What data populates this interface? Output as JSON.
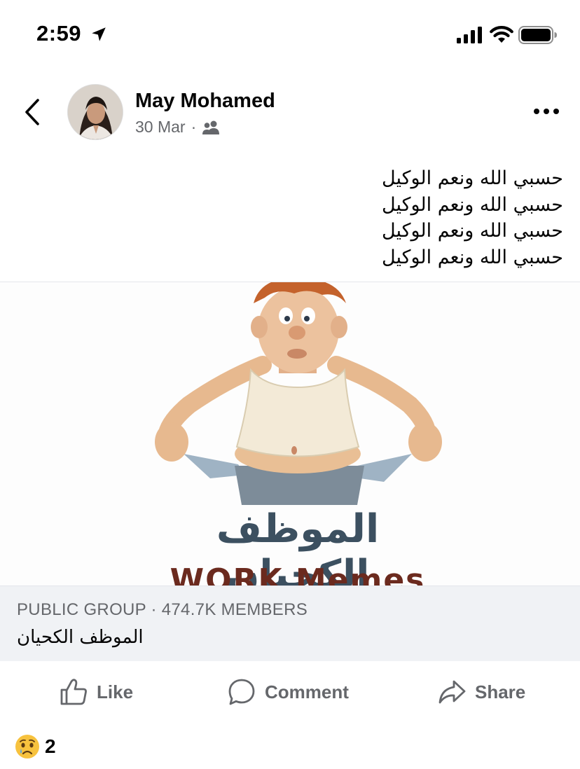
{
  "status_bar": {
    "time": "2:59",
    "icons": [
      "location-arrow-icon",
      "cellular-signal-icon",
      "wifi-icon",
      "battery-icon"
    ]
  },
  "post": {
    "author": "May Mohamed",
    "date": "30 Mar",
    "separator": "·",
    "audience_icon": "friends-icon",
    "text_lines": [
      "حسبي الله ونعم الوكيل",
      "حسبي الله ونعم الوكيل",
      "حسبي الله ونعم الوكيل",
      "حسبي الله ونعم الوكيل"
    ],
    "image": {
      "caption_arabic": "الموظف الكحيان",
      "caption_english": "WORK Memes"
    }
  },
  "group": {
    "meta": "PUBLIC GROUP · 474.7K MEMBERS",
    "name": "الموظف الكحيان"
  },
  "actions": {
    "like": "Like",
    "comment": "Comment",
    "share": "Share"
  },
  "reactions": {
    "icon": "sad-reaction-icon",
    "count": "2"
  },
  "colors": {
    "text_primary": "#050505",
    "text_secondary": "#65676b",
    "card_bg": "#f0f2f5"
  }
}
